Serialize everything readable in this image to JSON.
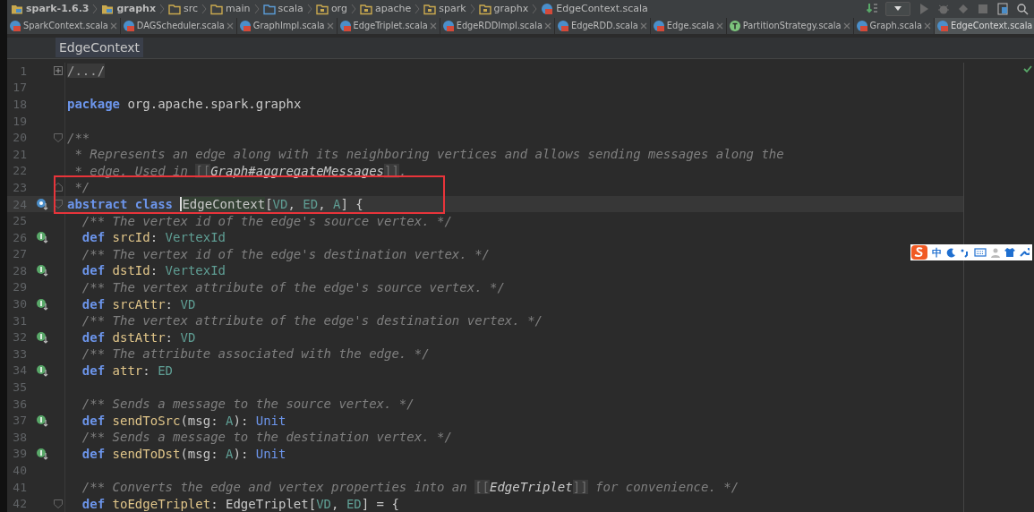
{
  "breadcrumbs": [
    {
      "kind": "module",
      "label": "spark-1.6.3"
    },
    {
      "kind": "module",
      "label": "graphx"
    },
    {
      "kind": "folder",
      "label": "src"
    },
    {
      "kind": "folder",
      "label": "main"
    },
    {
      "kind": "source",
      "label": "scala"
    },
    {
      "kind": "package",
      "label": "org"
    },
    {
      "kind": "package",
      "label": "apache"
    },
    {
      "kind": "package",
      "label": "spark"
    },
    {
      "kind": "package",
      "label": "graphx"
    },
    {
      "kind": "file",
      "label": "EdgeContext.scala"
    }
  ],
  "tabs": [
    {
      "kind": "class",
      "label": "SparkContext.scala",
      "selected": false
    },
    {
      "kind": "class",
      "label": "DAGScheduler.scala",
      "selected": false
    },
    {
      "kind": "class",
      "label": "GraphImpl.scala",
      "selected": false
    },
    {
      "kind": "class",
      "label": "EdgeTriplet.scala",
      "selected": false
    },
    {
      "kind": "class",
      "label": "EdgeRDDImpl.scala",
      "selected": false
    },
    {
      "kind": "class",
      "label": "EdgeRDD.scala",
      "selected": false
    },
    {
      "kind": "class",
      "label": "Edge.scala",
      "selected": false
    },
    {
      "kind": "trait",
      "label": "PartitionStrategy.scala",
      "selected": false
    },
    {
      "kind": "class",
      "label": "Graph.scala",
      "selected": false
    },
    {
      "kind": "class",
      "label": "EdgeContext.scala",
      "selected": true
    }
  ],
  "editor": {
    "header": "EdgeContext",
    "lines": [
      {
        "number": "1",
        "fold": {
          "kind": "collapsed"
        },
        "current": false,
        "tokens": [
          {
            "kind": "folded",
            "text": "/.../"
          }
        ]
      },
      {
        "number": "17",
        "current": false
      },
      {
        "number": "18",
        "current": false,
        "tokens": [
          {
            "kind": "keyword",
            "text": "package"
          },
          {
            "kind": "plain",
            "text": " org.apache.spark.graphx"
          }
        ]
      },
      {
        "number": "19",
        "current": false
      },
      {
        "number": "20",
        "fold": {
          "kind": "start"
        },
        "current": false,
        "tokens": [
          {
            "kind": "comment",
            "text": "/**"
          }
        ]
      },
      {
        "number": "21",
        "current": false,
        "tokens": [
          {
            "kind": "comment",
            "text": " * Represents an edge along with its neighboring vertices and allows sending messages along the"
          }
        ]
      },
      {
        "number": "22",
        "current": false,
        "tokens": [
          {
            "kind": "comment",
            "text": " * edge. Used in "
          },
          {
            "kind": "bracket",
            "text": "[["
          },
          {
            "kind": "docref",
            "text": "Graph#aggregateMessages"
          },
          {
            "kind": "bracket",
            "text": "]]"
          },
          {
            "kind": "comment",
            "text": "."
          }
        ]
      },
      {
        "number": "23",
        "fold": {
          "kind": "end"
        },
        "current": false,
        "tokens": [
          {
            "kind": "comment",
            "text": " */"
          }
        ]
      },
      {
        "number": "24",
        "marker": {
          "kind": "overridden"
        },
        "fold": {
          "kind": "start"
        },
        "current": true,
        "tokens": [
          {
            "kind": "keyword",
            "text": "abstract class "
          },
          {
            "kind": "highlight",
            "text": "EdgeContext"
          },
          {
            "kind": "plain",
            "text": "["
          },
          {
            "kind": "type",
            "text": "VD"
          },
          {
            "kind": "plain",
            "text": ", "
          },
          {
            "kind": "type",
            "text": "ED"
          },
          {
            "kind": "plain",
            "text": ", "
          },
          {
            "kind": "type",
            "text": "A"
          },
          {
            "kind": "plain",
            "text": "] {"
          }
        ]
      },
      {
        "number": "25",
        "current": false,
        "tokens": [
          {
            "kind": "comment",
            "text": "  /** The vertex id of the edge's source vertex. */"
          }
        ]
      },
      {
        "number": "26",
        "marker": {
          "kind": "implements"
        },
        "current": false,
        "tokens": [
          {
            "kind": "keyword",
            "text": "  def "
          },
          {
            "kind": "member",
            "text": "srcId"
          },
          {
            "kind": "plain",
            "text": ": "
          },
          {
            "kind": "type",
            "text": "VertexId"
          }
        ]
      },
      {
        "number": "27",
        "current": false,
        "tokens": [
          {
            "kind": "comment",
            "text": "  /** The vertex id of the edge's destination vertex. */"
          }
        ]
      },
      {
        "number": "28",
        "marker": {
          "kind": "implements"
        },
        "current": false,
        "tokens": [
          {
            "kind": "keyword",
            "text": "  def "
          },
          {
            "kind": "member",
            "text": "dstId"
          },
          {
            "kind": "plain",
            "text": ": "
          },
          {
            "kind": "type",
            "text": "VertexId"
          }
        ]
      },
      {
        "number": "29",
        "current": false,
        "tokens": [
          {
            "kind": "comment",
            "text": "  /** The vertex attribute of the edge's source vertex. */"
          }
        ]
      },
      {
        "number": "30",
        "marker": {
          "kind": "implements"
        },
        "current": false,
        "tokens": [
          {
            "kind": "keyword",
            "text": "  def "
          },
          {
            "kind": "member",
            "text": "srcAttr"
          },
          {
            "kind": "plain",
            "text": ": "
          },
          {
            "kind": "type",
            "text": "VD"
          }
        ]
      },
      {
        "number": "31",
        "current": false,
        "tokens": [
          {
            "kind": "comment",
            "text": "  /** The vertex attribute of the edge's destination vertex. */"
          }
        ]
      },
      {
        "number": "32",
        "marker": {
          "kind": "implements"
        },
        "current": false,
        "tokens": [
          {
            "kind": "keyword",
            "text": "  def "
          },
          {
            "kind": "member",
            "text": "dstAttr"
          },
          {
            "kind": "plain",
            "text": ": "
          },
          {
            "kind": "type",
            "text": "VD"
          }
        ]
      },
      {
        "number": "33",
        "current": false,
        "tokens": [
          {
            "kind": "comment",
            "text": "  /** The attribute associated with the edge. */"
          }
        ]
      },
      {
        "number": "34",
        "marker": {
          "kind": "implements"
        },
        "current": false,
        "tokens": [
          {
            "kind": "keyword",
            "text": "  def "
          },
          {
            "kind": "member",
            "text": "attr"
          },
          {
            "kind": "plain",
            "text": ": "
          },
          {
            "kind": "type",
            "text": "ED"
          }
        ]
      },
      {
        "number": "35",
        "current": false
      },
      {
        "number": "36",
        "current": false,
        "tokens": [
          {
            "kind": "comment",
            "text": "  /** Sends a message to the source vertex. */"
          }
        ]
      },
      {
        "number": "37",
        "marker": {
          "kind": "implements"
        },
        "current": false,
        "tokens": [
          {
            "kind": "keyword",
            "text": "  def "
          },
          {
            "kind": "member",
            "text": "sendToSrc"
          },
          {
            "kind": "plain",
            "text": "(msg: "
          },
          {
            "kind": "type",
            "text": "A"
          },
          {
            "kind": "plain",
            "text": "): "
          },
          {
            "kind": "builtin",
            "text": "Unit"
          }
        ]
      },
      {
        "number": "38",
        "current": false,
        "tokens": [
          {
            "kind": "comment",
            "text": "  /** Sends a message to the destination vertex. */"
          }
        ]
      },
      {
        "number": "39",
        "marker": {
          "kind": "implements"
        },
        "current": false,
        "tokens": [
          {
            "kind": "keyword",
            "text": "  def "
          },
          {
            "kind": "member",
            "text": "sendToDst"
          },
          {
            "kind": "plain",
            "text": "(msg: "
          },
          {
            "kind": "type",
            "text": "A"
          },
          {
            "kind": "plain",
            "text": "): "
          },
          {
            "kind": "builtin",
            "text": "Unit"
          }
        ]
      },
      {
        "number": "40",
        "current": false
      },
      {
        "number": "41",
        "current": false,
        "tokens": [
          {
            "kind": "comment",
            "text": "  /** Converts the edge and vertex properties into an "
          },
          {
            "kind": "bracket",
            "text": "[["
          },
          {
            "kind": "docref",
            "text": "EdgeTriplet"
          },
          {
            "kind": "bracket",
            "text": "]]"
          },
          {
            "kind": "comment",
            "text": " for convenience. */"
          }
        ]
      },
      {
        "number": "42",
        "fold": {
          "kind": "start"
        },
        "current": false,
        "tokens": [
          {
            "kind": "keyword",
            "text": "  def "
          },
          {
            "kind": "member",
            "text": "toEdgeTriplet"
          },
          {
            "kind": "plain",
            "text": ": EdgeTriplet["
          },
          {
            "kind": "type",
            "text": "VD"
          },
          {
            "kind": "plain",
            "text": ", "
          },
          {
            "kind": "type",
            "text": "ED"
          },
          {
            "kind": "plain",
            "text": "] = {"
          }
        ]
      }
    ]
  },
  "ime_toolbar": {
    "mode": "中"
  }
}
